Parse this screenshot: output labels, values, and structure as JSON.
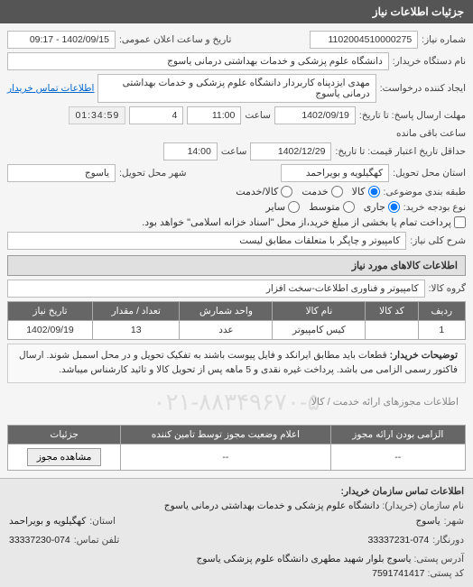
{
  "header": {
    "title": "جزئیات اطلاعات نیاز"
  },
  "fields": {
    "request_no_label": "شماره نیاز:",
    "request_no": "1102004510000275",
    "announce_label": "تاریخ و ساعت اعلان عمومی:",
    "announce_value": "1402/09/15 - 09:17",
    "buyer_label": "نام دستگاه خریدار:",
    "buyer_value": "دانشگاه علوم پزشکی و خدمات بهداشتی  درمانی یاسوج",
    "requester_label": "ایجاد کننده درخواست:",
    "requester_value": "مهدی ایزدپناه کاربردار دانشگاه علوم پزشکی و خدمات بهداشتی  درمانی یاسوج",
    "contact_link": "اطلاعات تماس خریدار",
    "deadline_send_label": "مهلت ارسال پاسخ: تا تاریخ:",
    "deadline_date": "1402/09/19",
    "deadline_time_label": "ساعت",
    "deadline_time": "11:00",
    "remaining_days": "4",
    "remaining_time": "01:34:59",
    "remaining_suffix": "ساعت باقی مانده",
    "validity_label": "حداقل تاریخ اعتبار قیمت: تا تاریخ:",
    "validity_date": "1402/12/29",
    "validity_time": "14:00",
    "province_label": "استان محل تحویل:",
    "province_value": "کهگیلویه و بویراحمد",
    "city_label": "شهر محل تحویل:",
    "city_value": "یاسوج",
    "category_label": "طبقه بندی موضوعی:",
    "category_goods": "کالا",
    "category_service": "خدمت",
    "category_mix": "کالا/خدمت",
    "type_label": "نوع بودجه خرید:",
    "type_current": "جاری",
    "type_capital": "متوسط",
    "type_other": "سایر",
    "payment_note": "پرداخت تمام یا بخشی از مبلغ خرید،از محل \"اسناد خزانه اسلامی\" خواهد بود.",
    "subject_label": "شرح کلی نیاز:",
    "subject_value": "کامپیوتر و چاپگر با متعلقات مطابق لیست"
  },
  "goods_section": {
    "title": "اطلاعات کالاهای مورد نیاز",
    "group_label": "گروه کالا:",
    "group_value": "کامپیوتر و فناوری اطلاعات-سخت افزار",
    "columns": {
      "row": "ردیف",
      "code": "کد کالا",
      "name": "نام کالا",
      "unit": "واحد شمارش",
      "qty": "تعداد / مقدار",
      "date": "تاریخ نیاز"
    },
    "rows": [
      {
        "row": "1",
        "code": "",
        "name": "کیس کامپیوتر",
        "unit": "عدد",
        "qty": "13",
        "date": "1402/09/19"
      }
    ],
    "buyer_note_label": "توضیحات خریدار:",
    "buyer_note": "قطعات باید مطابق ایرانکد و فایل پیوست باشند به تفکیک تحویل و در محل اسمبل شوند. ارسال فاکتور رسمی الزامی می باشد. پرداخت غیره نقدی و 5 ماهه پس از تحویل کالا و تائید کارشناس میباشد."
  },
  "permit_section": {
    "title": "اطلاعات مجوزهای ارائه خدمت / کالا",
    "watermark": "۰۲۱-۸۸۳۴۹۶۷۰-۵",
    "columns": {
      "mandatory": "الزامی بودن ارائه مجوز",
      "status": "اعلام وضعیت مجوز توسط تامین کننده",
      "view": "جزئیات"
    },
    "row": {
      "mandatory": "--",
      "status": "--",
      "view_btn": "مشاهده مجوز"
    }
  },
  "org_section": {
    "title": "اطلاعات تماس سازمان خریدار:",
    "org_label": "نام سازمان (خریدار):",
    "org_value": "دانشگاه علوم پزشکی و خدمات بهداشتی درمانی یاسوج",
    "city_label": "شهر:",
    "city_value": "یاسوج",
    "province_label": "استان:",
    "province_value": "کهگیلویه و بویراحمد",
    "fax_label": "دورنگار:",
    "fax_value": "33337231-074",
    "phone_label": "تلفن تماس:",
    "phone_value": "33337230-074",
    "address_label": "آدرس پستی:",
    "address_value": "یاسوج بلوار شهید مطهری دانشگاه علوم پزشکی یاسوج",
    "postal_label": "کد پستی:",
    "postal_value": "7591741417"
  }
}
